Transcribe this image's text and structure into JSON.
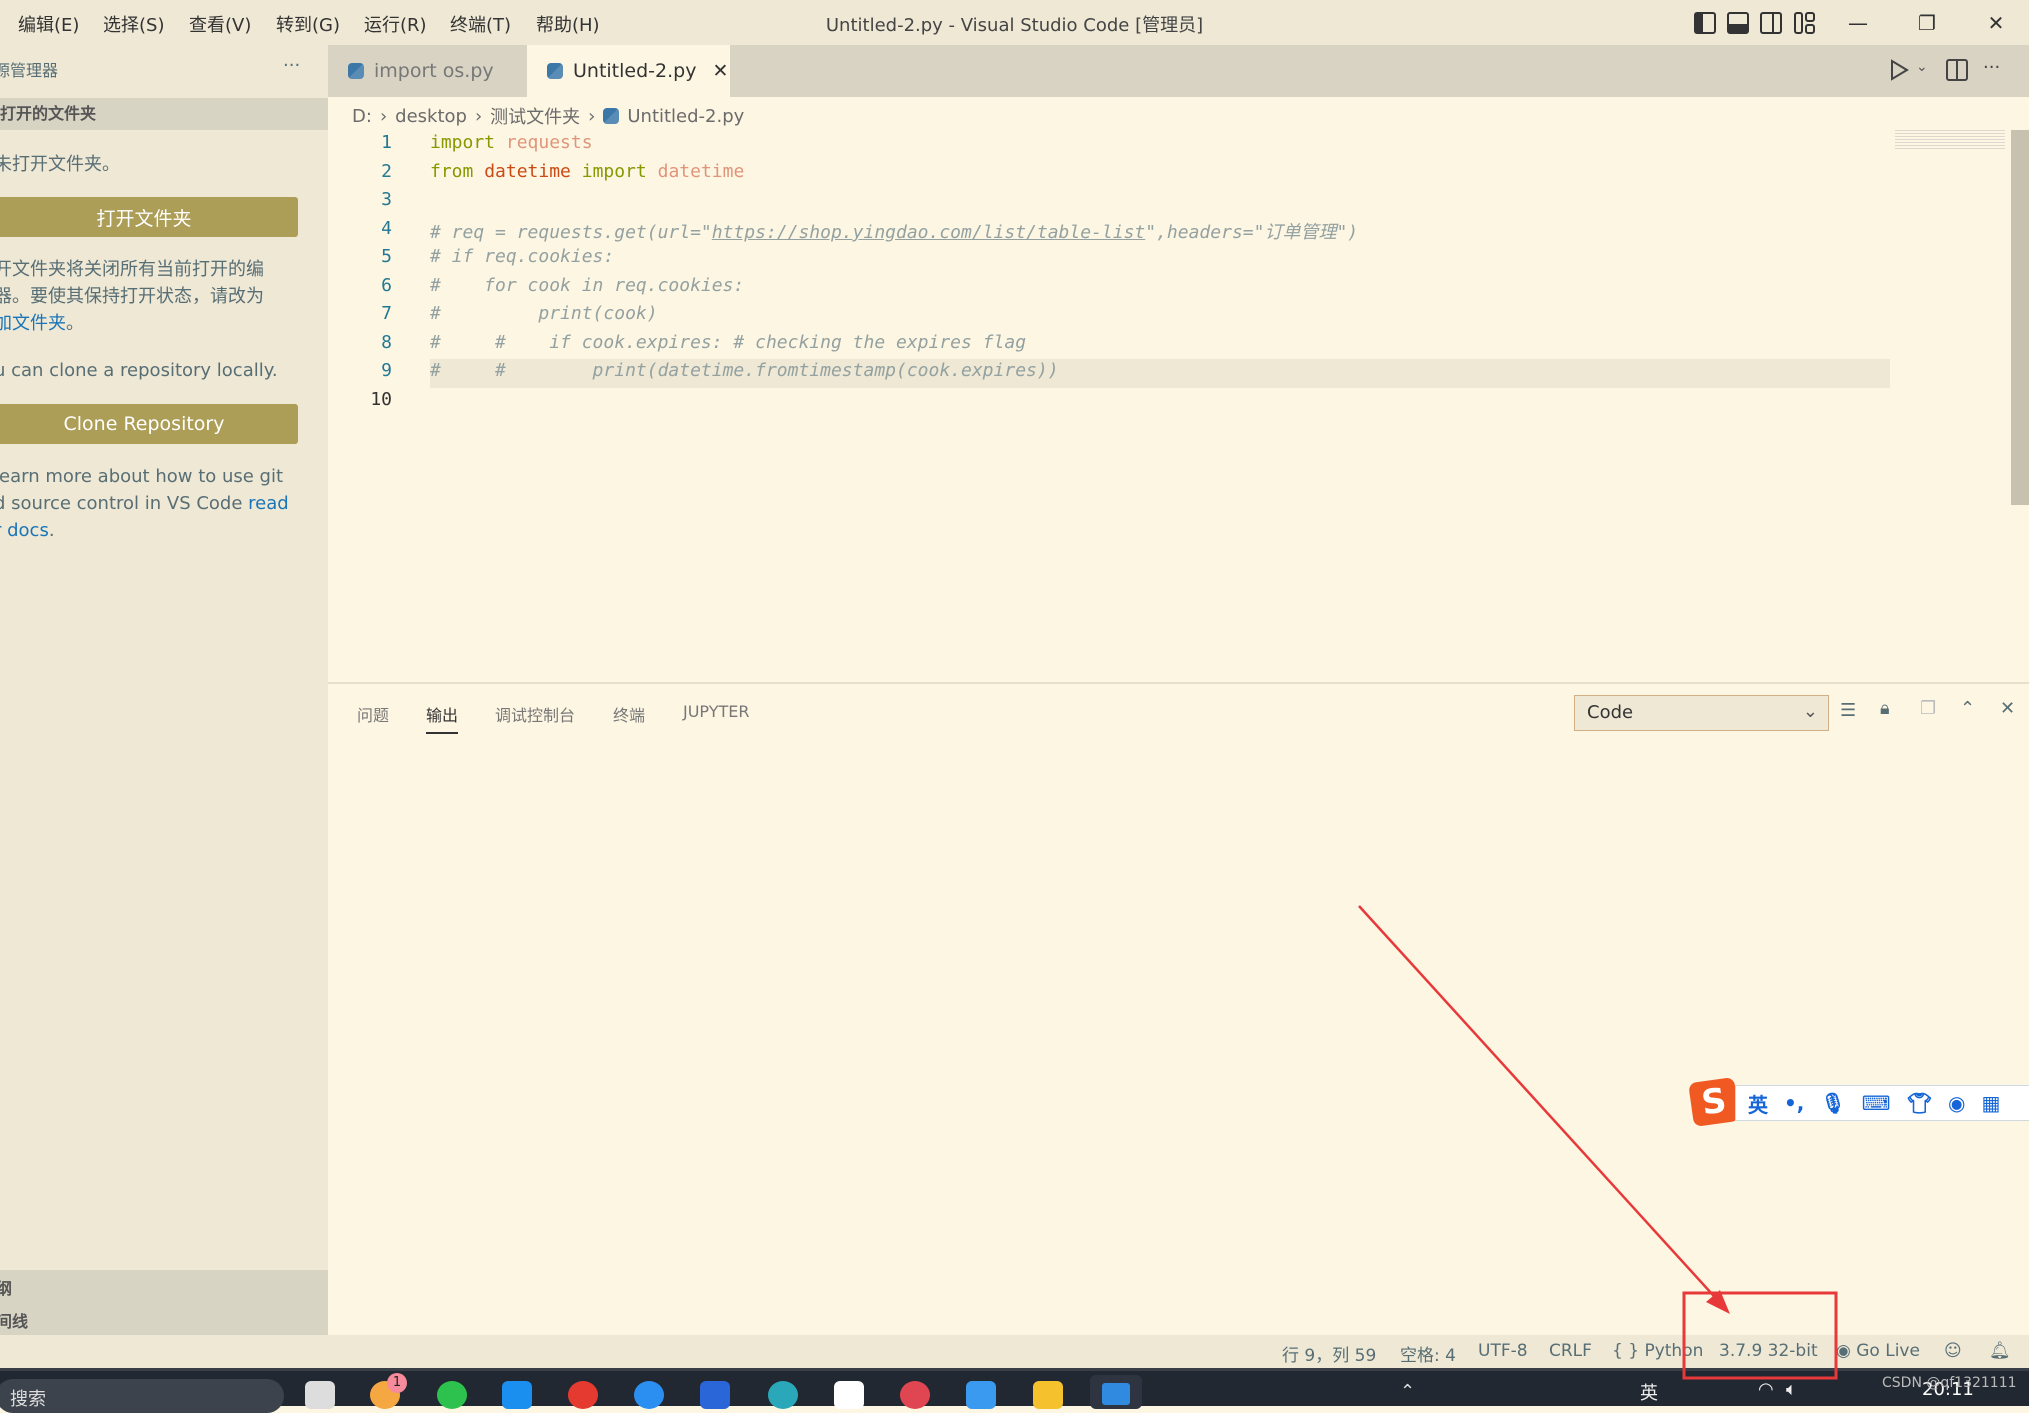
{
  "titlebar": {
    "menus": [
      "编辑(E)",
      "选择(S)",
      "查看(V)",
      "转到(G)",
      "运行(R)",
      "终端(T)",
      "帮助(H)"
    ],
    "title": "Untitled-2.py - Visual Studio Code [管理员]"
  },
  "sidebar": {
    "header": "源管理器",
    "more": "···",
    "section": "打开的文件夹",
    "no_folder": "未打开文件夹。",
    "open_folder_button": "打开文件夹",
    "info_line1": "开文件夹将关闭所有当前打开的编",
    "info_line2": "器。要使其保持打开状态，请改为",
    "info_link": "加文件夹",
    "info_end": "。",
    "clone_text": "u can clone a repository locally.",
    "clone_button": "Clone Repository",
    "learn_line1": "learn more about how to use git",
    "learn_line2": "d source control in VS Code ",
    "learn_link1": "read",
    "learn_link2": "r docs",
    "learn_end": ".",
    "bottom_sections": [
      "纲",
      "间线"
    ]
  },
  "tabs": [
    {
      "label": "import os.py",
      "active": false
    },
    {
      "label": "Untitled-2.py",
      "active": true
    }
  ],
  "breadcrumb": [
    "D:",
    "desktop",
    "测试文件夹",
    "Untitled-2.py"
  ],
  "code": {
    "line_numbers": [
      "1",
      "2",
      "3",
      "4",
      "5",
      "6",
      "7",
      "8",
      "9",
      "10"
    ],
    "l1a": "import",
    "l1b": "requests",
    "l2a": "from",
    "l2b": "datetime",
    "l2c": "import",
    "l2d": "datetime",
    "l4a": "# req = requests.get(url=\"",
    "l4b": "https://shop.yingdao.com/list/table-list",
    "l4c": "\",headers=\"订单管理\")",
    "l5": "# if req.cookies:",
    "l6": "#    for cook in req.cookies:",
    "l7": "#         print(cook)",
    "l8": "#     #    if cook.expires: # checking the expires flag",
    "l9": "#     #        print(datetime.fromtimestamp(cook.expires))"
  },
  "panel": {
    "tabs": [
      "问题",
      "输出",
      "调试控制台",
      "终端",
      "JUPYTER"
    ],
    "active_tab": "输出",
    "channel_select": "Code"
  },
  "statusbar": {
    "position": "行 9，列 59",
    "spaces": "空格: 4",
    "encoding": "UTF-8",
    "eol": "CRLF",
    "language": "Python",
    "interpreter": "3.7.9 32-bit",
    "golive": "Go Live"
  },
  "ime": {
    "mode": "英",
    "punct": "•,"
  },
  "taskbar": {
    "search": "搜索",
    "badge": "1",
    "clock": "20:11",
    "tray_lang": "英",
    "watermark": "CSDN @qf1321111"
  },
  "colors": {
    "accent_button": "#ac9d57",
    "annotation": "#e8393a",
    "sidebar_bg": "#eee8d5",
    "editor_bg": "#fdf6e3"
  }
}
